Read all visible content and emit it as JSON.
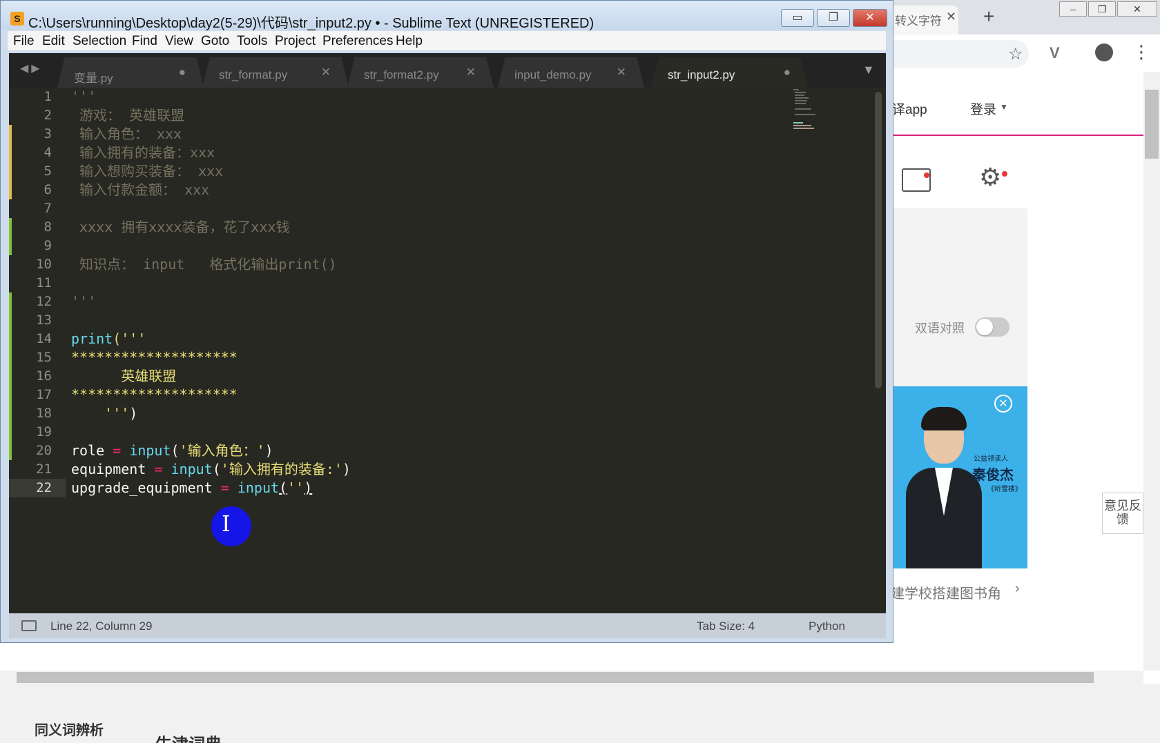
{
  "browser": {
    "tab_title": "转义字符",
    "tab_close": "✕",
    "new_tab": "+",
    "nav_app": "译app",
    "nav_login": "登录",
    "bilingual_label": "双语对照",
    "ad_close": "✕",
    "ad_tag": "公益领读人",
    "ad_name": "秦俊杰",
    "ad_subtitle": "《听雪楼》",
    "ad_caption": "建学校搭建图书角",
    "ad_caption_arrow": "›",
    "feedback": "意见反馈",
    "bottom_left": "同义词辨析",
    "bottom_mid": "牛津词典"
  },
  "window": {
    "title": "C:\\Users\\running\\Desktop\\day2(5-29)\\代码\\str_input2.py • - Sublime Text (UNREGISTERED)",
    "min": "▭",
    "max": "❐",
    "close": "✕"
  },
  "menubar": [
    "File",
    "Edit",
    "Selection",
    "Find",
    "View",
    "Goto",
    "Tools",
    "Project",
    "Preferences",
    "Help"
  ],
  "tabs": [
    {
      "label": "变量.py",
      "mark": "●",
      "active": false
    },
    {
      "label": "str_format.py",
      "mark": "✕",
      "active": false
    },
    {
      "label": "str_format2.py",
      "mark": "✕",
      "active": false
    },
    {
      "label": "input_demo.py",
      "mark": "✕",
      "active": false
    },
    {
      "label": "str_input2.py",
      "mark": "●",
      "active": true
    }
  ],
  "nav_arrows": "◀▶",
  "tab_dropdown": "▼",
  "line_numbers": [
    "1",
    "2",
    "3",
    "4",
    "5",
    "6",
    "7",
    "8",
    "9",
    "10",
    "11",
    "12",
    "13",
    "14",
    "15",
    "16",
    "17",
    "18",
    "19",
    "20",
    "21",
    "22"
  ],
  "current_line": "22",
  "code": {
    "l1": "'''",
    "l2": " 游戏： 英雄联盟",
    "l3": " 输入角色： xxx",
    "l4": " 输入拥有的装备：xxx",
    "l5": " 输入想购买装备： xxx",
    "l6": " 输入付款金额： xxx",
    "l8": " xxxx 拥有xxxx装备，花了xxx钱",
    "l10": " 知识点： input   格式化输出print()",
    "l12": "'''",
    "l14_fn": "print",
    "l14_rest": "('''",
    "l15": "********************",
    "l16": "      英雄联盟",
    "l17": "********************",
    "l18_str": "    '''",
    "l18_rest": ")",
    "l20_var": "role ",
    "l20_op": "=",
    "l20_fn": "input",
    "l20_p1": "(",
    "l20_str": "'输入角色：'",
    "l20_p2": ")",
    "l21_var": "equipment ",
    "l21_op": "=",
    "l21_fn": "input",
    "l21_p1": "(",
    "l21_str": "'输入拥有的装备:'",
    "l21_p2": ")",
    "l22_var": "upgrade_equipment ",
    "l22_op": "=",
    "l22_fn": "input",
    "l22_p1": "(",
    "l22_str": "''",
    "l22_p2": ")"
  },
  "status": {
    "position": "Line 22, Column 29",
    "tab_size": "Tab Size: 4",
    "syntax": "Python"
  },
  "cursor_glyph": "I"
}
